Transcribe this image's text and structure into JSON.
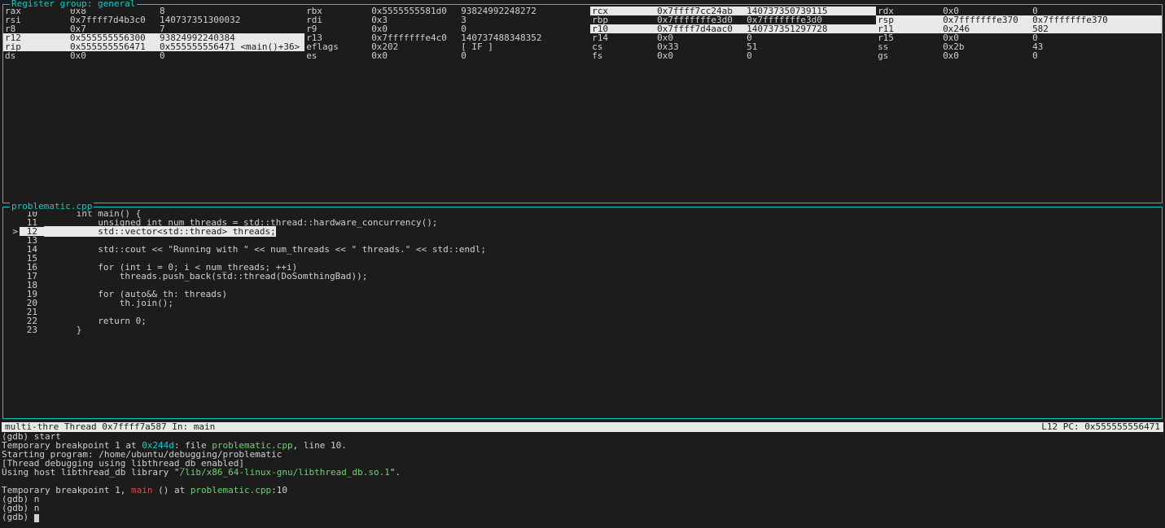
{
  "registers": {
    "title": "Register group: general",
    "rows": [
      [
        {
          "name": "rax",
          "hex": "0x8",
          "dec": "8",
          "hl": false
        },
        {
          "name": "rbx",
          "hex": "0x5555555581d0",
          "dec": "93824992248272",
          "hl": false
        },
        {
          "name": "rcx",
          "hex": "0x7ffff7cc24ab",
          "dec": "140737350739115",
          "hl": true
        },
        {
          "name": "rdx",
          "hex": "0x0",
          "dec": "0",
          "hl": false
        }
      ],
      [
        {
          "name": "rsi",
          "hex": "0x7ffff7d4b3c0",
          "dec": "140737351300032",
          "hl": false
        },
        {
          "name": "rdi",
          "hex": "0x3",
          "dec": "3",
          "hl": false
        },
        {
          "name": "rbp",
          "hex": "0x7fffffffe3d0",
          "dec": "0x7fffffffe3d0",
          "hl": false
        },
        {
          "name": "rsp",
          "hex": "0x7fffffffe370",
          "dec": "0x7fffffffe370",
          "hl": true
        }
      ],
      [
        {
          "name": "r8",
          "hex": "0x7",
          "dec": "7",
          "hl": false
        },
        {
          "name": "r9",
          "hex": "0x0",
          "dec": "0",
          "hl": false
        },
        {
          "name": "r10",
          "hex": "0x7ffff7d4aac0",
          "dec": "140737351297728",
          "hl": true
        },
        {
          "name": "r11",
          "hex": "0x246",
          "dec": "582",
          "hl": true
        }
      ],
      [
        {
          "name": "r12",
          "hex": "0x555555556300",
          "dec": "93824992240384",
          "hl": true
        },
        {
          "name": "r13",
          "hex": "0x7fffffffe4c0",
          "dec": "140737488348352",
          "hl": false
        },
        {
          "name": "r14",
          "hex": "0x0",
          "dec": "0",
          "hl": false
        },
        {
          "name": "r15",
          "hex": "0x0",
          "dec": "0",
          "hl": false
        }
      ],
      [
        {
          "name": "rip",
          "hex": "0x555555556471",
          "dec": "0x555555556471 <main()+36>",
          "hl": true
        },
        {
          "name": "eflags",
          "hex": "0x202",
          "dec": "[ IF ]",
          "hl": false
        },
        {
          "name": "cs",
          "hex": "0x33",
          "dec": "51",
          "hl": false
        },
        {
          "name": "ss",
          "hex": "0x2b",
          "dec": "43",
          "hl": false
        }
      ],
      [
        {
          "name": "ds",
          "hex": "0x0",
          "dec": "0",
          "hl": false
        },
        {
          "name": "es",
          "hex": "0x0",
          "dec": "0",
          "hl": false
        },
        {
          "name": "fs",
          "hex": "0x0",
          "dec": "0",
          "hl": false
        },
        {
          "name": "gs",
          "hex": "0x0",
          "dec": "0",
          "hl": false
        }
      ]
    ]
  },
  "source": {
    "title": "problematic.cpp",
    "lines": [
      {
        "n": "10",
        "gutter": "",
        "code": "      int main() {",
        "current": false
      },
      {
        "n": "11",
        "gutter": "",
        "code": "          unsigned int num_threads = std::thread::hardware_concurrency();",
        "current": false
      },
      {
        "n": "12",
        "gutter": ">",
        "code": "          std::vector<std::thread> threads;",
        "current": true
      },
      {
        "n": "13",
        "gutter": "",
        "code": "",
        "current": false
      },
      {
        "n": "14",
        "gutter": "",
        "code": "          std::cout << \"Running with \" << num_threads << \" threads.\" << std::endl;",
        "current": false
      },
      {
        "n": "15",
        "gutter": "",
        "code": "",
        "current": false
      },
      {
        "n": "16",
        "gutter": "",
        "code": "          for (int i = 0; i < num_threads; ++i)",
        "current": false
      },
      {
        "n": "17",
        "gutter": "",
        "code": "              threads.push_back(std::thread(DoSomthingBad));",
        "current": false
      },
      {
        "n": "18",
        "gutter": "",
        "code": "",
        "current": false
      },
      {
        "n": "19",
        "gutter": "",
        "code": "          for (auto&& th: threads)",
        "current": false
      },
      {
        "n": "20",
        "gutter": "",
        "code": "              th.join();",
        "current": false
      },
      {
        "n": "21",
        "gutter": "",
        "code": "",
        "current": false
      },
      {
        "n": "22",
        "gutter": "",
        "code": "          return 0;",
        "current": false
      },
      {
        "n": "23",
        "gutter": "",
        "code": "      }",
        "current": false
      }
    ]
  },
  "status": {
    "left": "multi-thre Thread 0x7ffff7a587 In: main",
    "right": "L12   PC: 0x555555556471"
  },
  "console": {
    "lines": [
      [
        {
          "t": "(gdb) start"
        }
      ],
      [
        {
          "t": "Temporary breakpoint 1 at "
        },
        {
          "t": "0x244d",
          "cls": "c-cyan"
        },
        {
          "t": ": file "
        },
        {
          "t": "problematic.cpp",
          "cls": "c-green"
        },
        {
          "t": ", line 10."
        }
      ],
      [
        {
          "t": "Starting program: /home/ubuntu/debugging/problematic"
        }
      ],
      [
        {
          "t": "[Thread debugging using libthread_db enabled]"
        }
      ],
      [
        {
          "t": "Using host libthread_db library \""
        },
        {
          "t": "/lib/x86_64-linux-gnu/libthread_db.so.1",
          "cls": "c-green"
        },
        {
          "t": "\"."
        }
      ],
      [
        {
          "t": " "
        }
      ],
      [
        {
          "t": "Temporary breakpoint 1, "
        },
        {
          "t": "main",
          "cls": "c-red"
        },
        {
          "t": " () at "
        },
        {
          "t": "problematic.cpp",
          "cls": "c-green"
        },
        {
          "t": ":10"
        }
      ],
      [
        {
          "t": "(gdb) n"
        }
      ],
      [
        {
          "t": "(gdb) n"
        }
      ],
      [
        {
          "t": "(gdb) "
        },
        {
          "cursor": true
        }
      ]
    ]
  }
}
